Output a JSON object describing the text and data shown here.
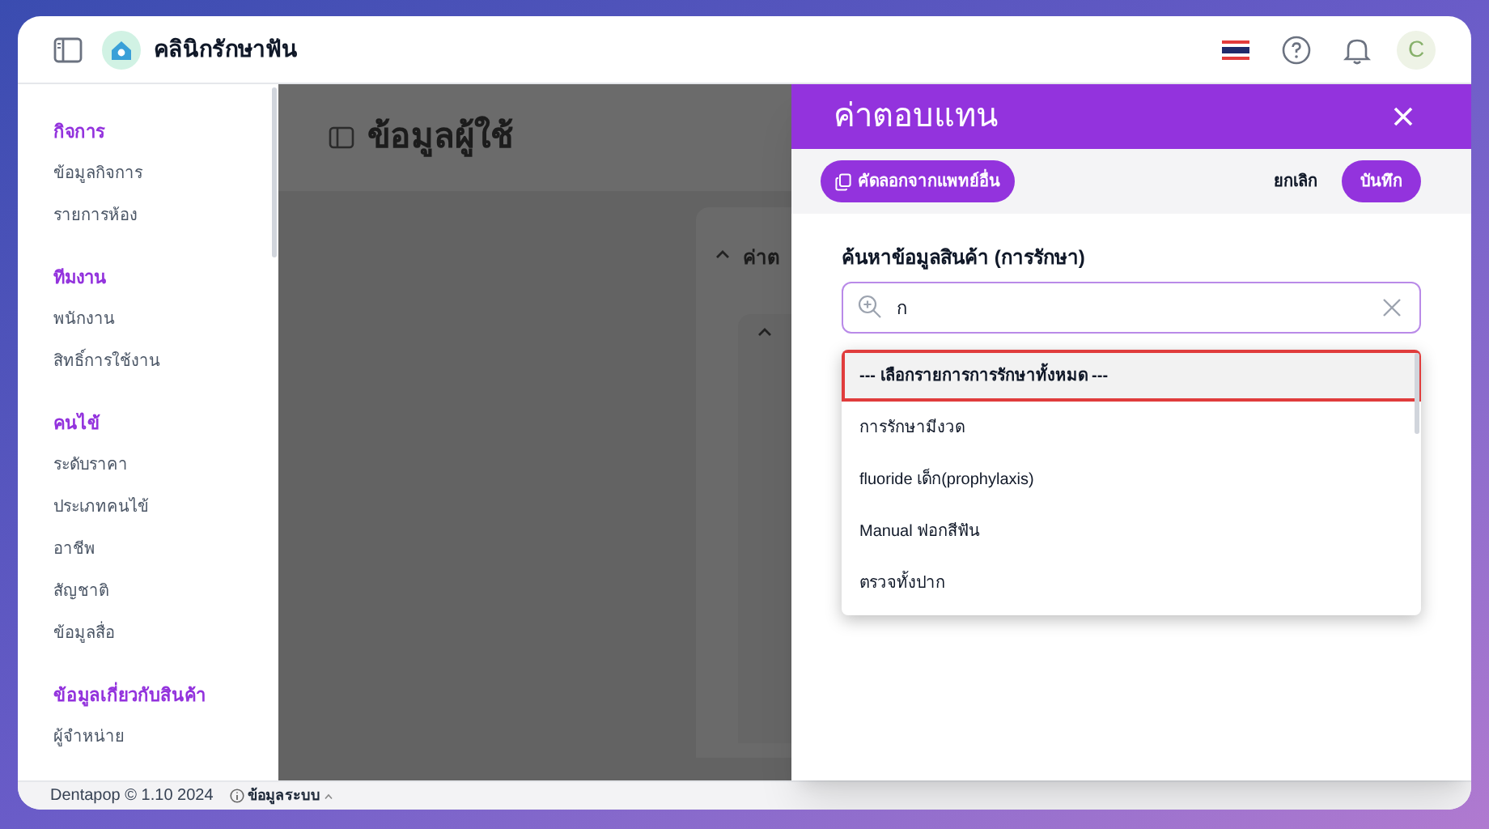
{
  "app": {
    "title": "คลินิกรักษาฟัน"
  },
  "sidebar": {
    "sections": [
      {
        "title": "กิจการ",
        "items": [
          "ข้อมูลกิจการ",
          "รายการห้อง"
        ]
      },
      {
        "title": "ทีมงาน",
        "items": [
          "พนักงาน",
          "สิทธิ์การใช้งาน"
        ]
      },
      {
        "title": "คนไข้",
        "items": [
          "ระดับราคา",
          "ประเภทคนไข้",
          "อาชีพ",
          "สัญชาติ",
          "ข้อมูลสื่อ"
        ]
      },
      {
        "title": "ข้อมูลเกี่ยวกับสินค้า",
        "items": [
          "ผู้จำหน่าย"
        ]
      }
    ]
  },
  "avatar": {
    "initial": "C"
  },
  "page": {
    "title": "ข้อมูลผู้ใช้",
    "card_heading": "ค่าต"
  },
  "drawer": {
    "title": "ค่าตอบแทน",
    "copy_button": "คัดลอกจากแพทย์อื่น",
    "cancel_button": "ยกเลิก",
    "save_button": "บันทึก",
    "search": {
      "label": "ค้นหาข้อมูลสินค้า (การรักษา)",
      "value": "ก"
    },
    "options": [
      {
        "label": "--- เลือกรายการการรักษาทั้งหมด ---",
        "selected": true,
        "highlighted": true
      },
      {
        "label": "การรักษามีงวด",
        "selected": false,
        "highlighted": false
      },
      {
        "label": "fluoride เด็ก(prophylaxis)",
        "selected": false,
        "highlighted": false
      },
      {
        "label": "Manual ฟอกสีฟัน",
        "selected": false,
        "highlighted": false
      },
      {
        "label": "ตรวจทั้งปาก",
        "selected": false,
        "highlighted": false
      }
    ]
  },
  "footer": {
    "version": "Dentapop © 1.10 2024",
    "system_info": "ข้อมูลระบบ"
  }
}
